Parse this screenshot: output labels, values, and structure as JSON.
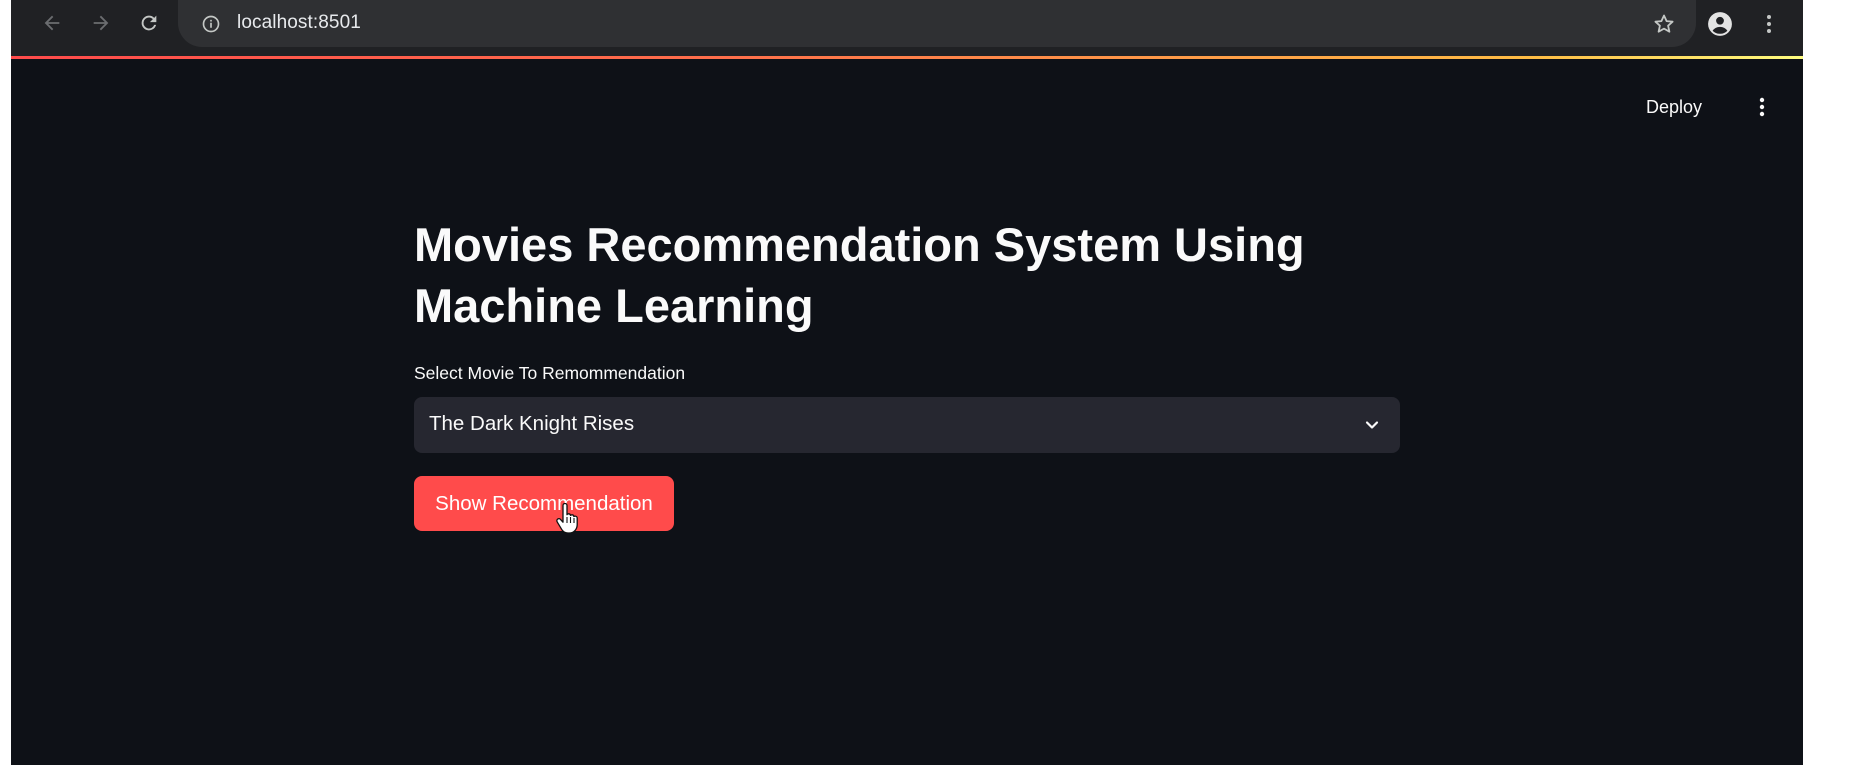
{
  "browser": {
    "url": "localhost:8501",
    "accent_gradient": [
      "#ff4b4b",
      "#ffbd45",
      "#fffd80"
    ]
  },
  "header": {
    "deploy_label": "Deploy"
  },
  "main": {
    "title": "Movies Recommendation System Using Machine Learning",
    "select_label": "Select Movie To Remommendation",
    "selected_movie": "The Dark Knight Rises",
    "button_label": "Show Recommendation"
  },
  "colors": {
    "background": "#0e1117",
    "primary": "#ff4b4b",
    "select_bg": "#262730",
    "text": "#fafafa"
  }
}
